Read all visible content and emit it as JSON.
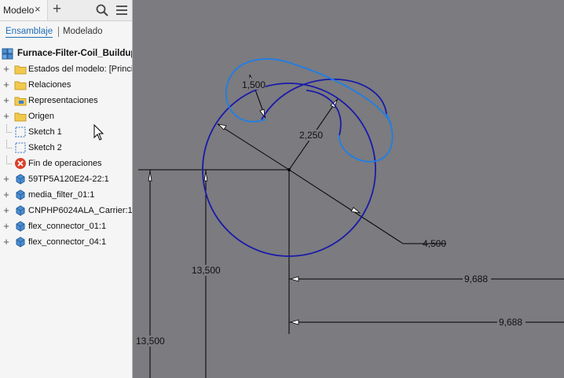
{
  "tabs": {
    "model_label": "Modelo",
    "close_glyph": "×",
    "add_glyph": "+"
  },
  "toolbar": {
    "search_icon": "search-icon",
    "menu_icon": "hamburger-menu-icon"
  },
  "subtabs": {
    "assembly": "Ensamblaje",
    "modeling": "Modelado"
  },
  "browser": {
    "root": "Furnace-Filter-Coil_Buildup",
    "items": [
      {
        "label": "Estados del modelo: [Principal]",
        "icon": "folder-icon",
        "expandable": true
      },
      {
        "label": "Relaciones",
        "icon": "folder-icon",
        "expandable": true
      },
      {
        "label": "Representaciones",
        "icon": "representations-folder-icon",
        "expandable": true
      },
      {
        "label": "Origen",
        "icon": "folder-icon",
        "expandable": true
      },
      {
        "label": "Sketch 1",
        "icon": "sketch-icon",
        "expandable": false
      },
      {
        "label": "Sketch 2",
        "icon": "sketch-icon",
        "expandable": false
      },
      {
        "label": "Fin de operaciones",
        "icon": "end-of-part-icon",
        "expandable": false
      },
      {
        "label": "59TP5A120E24-22:1",
        "icon": "component-icon",
        "expandable": true
      },
      {
        "label": "media_filter_01:1",
        "icon": "component-icon",
        "expandable": true
      },
      {
        "label": "CNPHP6024ALA_Carrier:1",
        "icon": "component-icon",
        "expandable": true
      },
      {
        "label": "flex_connector_01:1",
        "icon": "component-icon",
        "expandable": true
      },
      {
        "label": "flex_connector_04:1",
        "icon": "component-icon",
        "expandable": true
      }
    ]
  },
  "sketch": {
    "dimensions": {
      "d1": "1,500",
      "d2": "2,250",
      "d3": "4,500",
      "d4": "13,500",
      "d5": "13,500",
      "d6": "9,688",
      "d7": "9,688"
    }
  },
  "colors": {
    "canvas": "#7b7b80",
    "sketch_circle": "#1a1aa8",
    "sketch_spline": "#1e7ee6",
    "dimension": "#000000",
    "link": "#1f6fb5"
  }
}
